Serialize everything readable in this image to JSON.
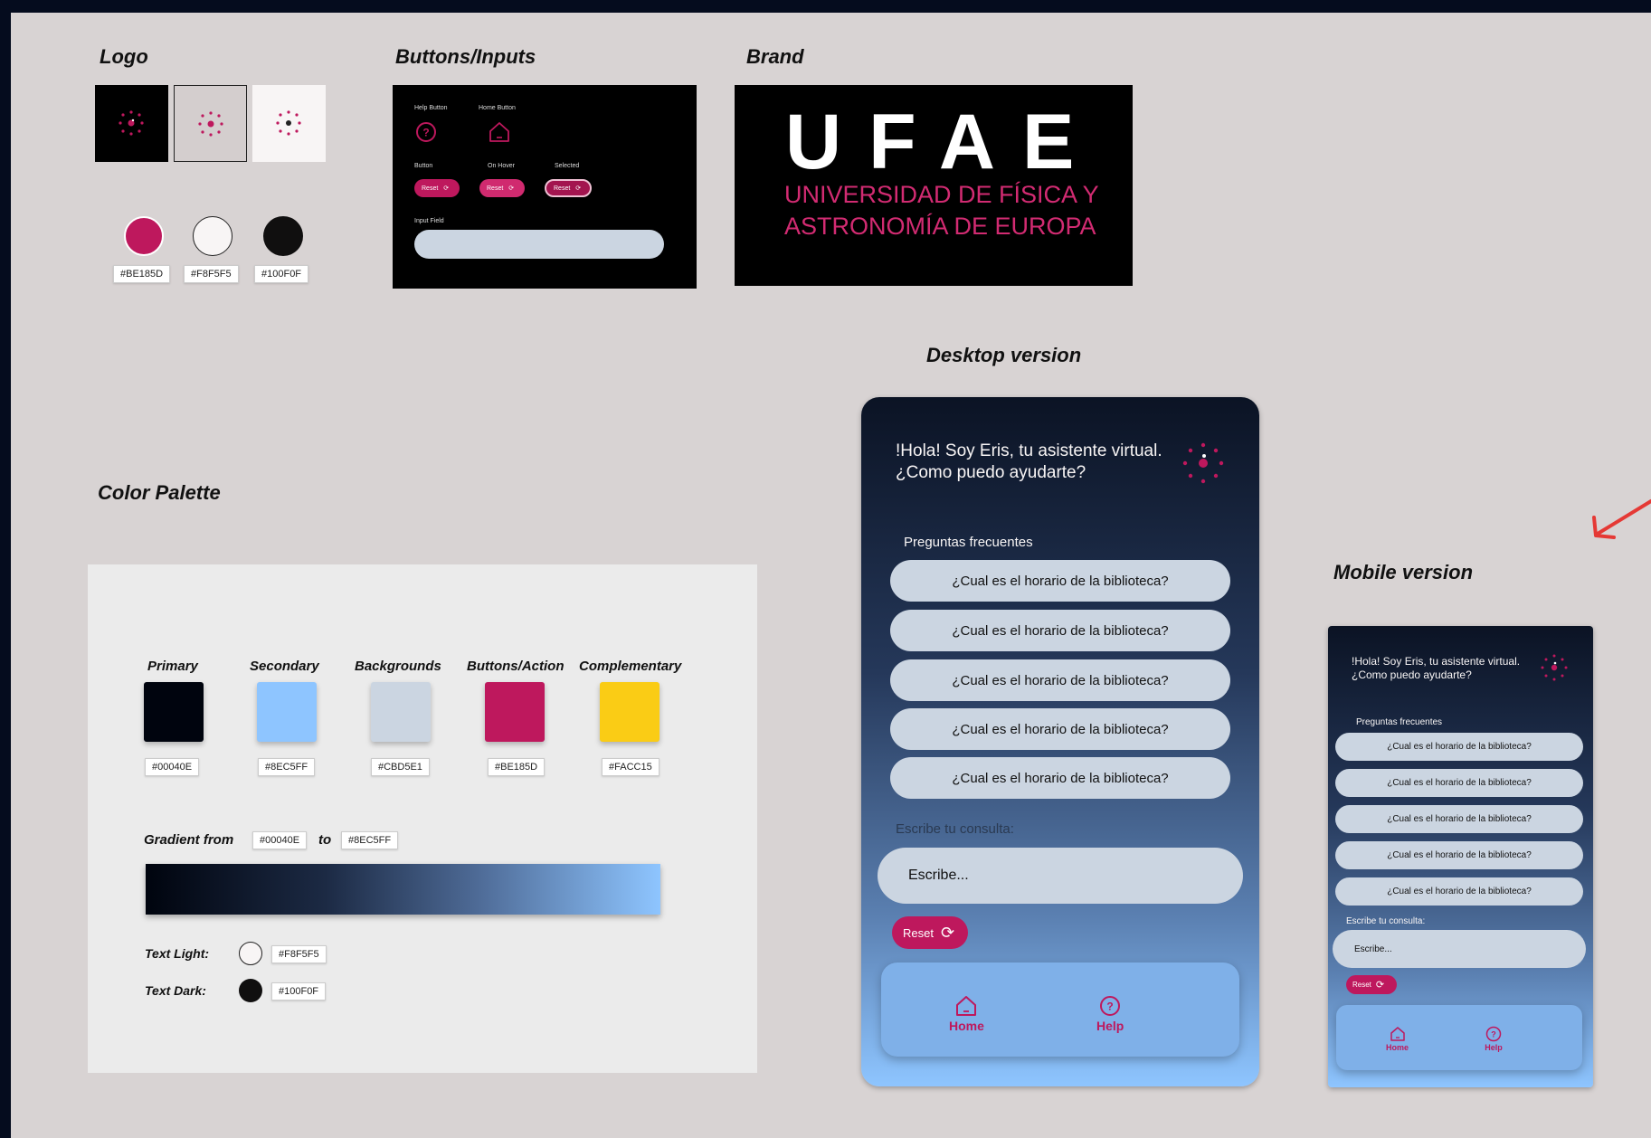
{
  "sections": {
    "logo": "Logo",
    "buttons_inputs": "Buttons/Inputs",
    "brand": "Brand",
    "color_palette": "Color Palette",
    "desktop": "Desktop version",
    "mobile": "Mobile version"
  },
  "logo_colors": [
    {
      "hex": "#BE185D",
      "label": "#BE185D"
    },
    {
      "hex": "#F8F5F5",
      "label": "#F8F5F5"
    },
    {
      "hex": "#100F0F",
      "label": "#100F0F"
    }
  ],
  "buttons_inputs": {
    "help_button": "Help Button",
    "home_button": "Home Button",
    "button": "Button",
    "on_hover": "On Hover",
    "selected": "Selected",
    "reset": "Reset",
    "input_field": "Input Field"
  },
  "brand": {
    "letters": "UFAE",
    "line1": "UNIVERSIDAD DE FÍSICA Y",
    "line2": "ASTRONOMÍA DE EUROPA"
  },
  "palette": {
    "swatches": [
      {
        "name": "Primary",
        "hex": "#00040E",
        "label": "#00040E"
      },
      {
        "name": "Secondary",
        "hex": "#8EC5FF",
        "label": "#8EC5FF"
      },
      {
        "name": "Backgrounds",
        "hex": "#CBD5E1",
        "label": "#CBD5E1"
      },
      {
        "name": "Buttons/Action",
        "hex": "#BE185D",
        "label": "#BE185D"
      },
      {
        "name": "Complementary",
        "hex": "#FACC15",
        "label": "#FACC15"
      }
    ],
    "gradient_from_label": "Gradient from",
    "gradient_from": "#00040E",
    "gradient_to_label": "to",
    "gradient_to": "#8EC5FF",
    "text_light_label": "Text Light:",
    "text_light": "#F8F5F5",
    "text_dark_label": "Text Dark:",
    "text_dark": "#100F0F"
  },
  "chat": {
    "greeting_line1": "!Hola! Soy Eris, tu asistente virtual.",
    "greeting_line2": "¿Como puedo ayudarte?",
    "faq_heading": "Preguntas frecuentes",
    "faqs": [
      "¿Cual es el horario de la biblioteca?",
      "¿Cual es el horario de la biblioteca?",
      "¿Cual es el horario de la biblioteca?",
      "¿Cual es el horario de la biblioteca?",
      "¿Cual es el horario de la biblioteca?"
    ],
    "query_label": "Escribe tu consulta:",
    "input_placeholder": "Escribe...",
    "reset": "Reset",
    "nav_home": "Home",
    "nav_help": "Help"
  },
  "colors": {
    "canvas": "#d8d3d3",
    "frame": "#050c1e",
    "accent": "#be185d",
    "arrow": "#e53935"
  }
}
